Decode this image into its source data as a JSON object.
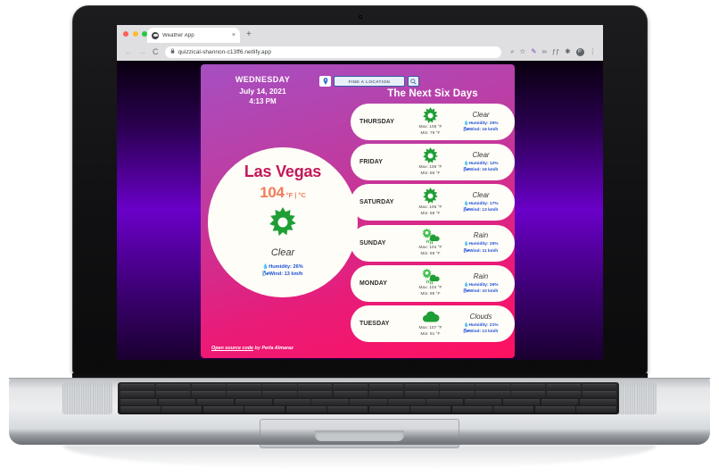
{
  "browser": {
    "tab_title": "Weather App",
    "tab_favicon": "partly-cloudy-icon",
    "tab_close": "×",
    "new_tab": "+",
    "back": "←",
    "forward": "→",
    "reload": "C",
    "lock": "🔒",
    "url": "quizzical-shannon-c13ff6.netlify.app",
    "zoom_icon": "⌕",
    "bookmark_icon": "☆",
    "ext1": "✎",
    "ext2": "∞",
    "ext3": "ƒƒ",
    "ext4": "✱",
    "profile_initial": "P",
    "menu_icon": "⋮"
  },
  "app": {
    "day_of_week": "WEDNESDAY",
    "date": "July 14, 2021",
    "time": "4:13 PM",
    "geo_icon": "location-pin-icon",
    "search_placeholder": "FIND A LOCATION",
    "search_icon": "search-icon",
    "forecast_title": "The Next Six Days",
    "current": {
      "city": "Las Vegas",
      "temperature": "104",
      "unit_active": "°F",
      "unit_separator": "|",
      "unit_inactive": "°C",
      "icon": "sun-icon",
      "condition": "Clear",
      "humidity": "Humidity: 26%",
      "wind": "Wind: 13 km/h",
      "humidity_icon": "droplet-icon",
      "wind_icon": "wind-icon"
    },
    "forecast": [
      {
        "day": "THURSDAY",
        "icon": "sun-icon",
        "max": "Max: 105 °F",
        "min": "Min: 79 °F",
        "condition": "Clear",
        "humidity": "Humidity: 25%",
        "wind": "Wind: 16 km/h"
      },
      {
        "day": "FRIDAY",
        "icon": "sun-icon",
        "max": "Max: 106 °F",
        "min": "Min: 86 °F",
        "condition": "Clear",
        "humidity": "Humidity: 12%",
        "wind": "Wind: 16 km/h"
      },
      {
        "day": "SATURDAY",
        "icon": "sun-icon",
        "max": "Max: 106 °F",
        "min": "Min: 88 °F",
        "condition": "Clear",
        "humidity": "Humidity: 17%",
        "wind": "Wind: 13 km/h"
      },
      {
        "day": "SUNDAY",
        "icon": "sun-rain-icon",
        "max": "Max: 104 °F",
        "min": "Min: 89 °F",
        "condition": "Rain",
        "humidity": "Humidity: 25%",
        "wind": "Wind: 11 km/h"
      },
      {
        "day": "MONDAY",
        "icon": "sun-rain-icon",
        "max": "Max: 104 °F",
        "min": "Min: 89 °F",
        "condition": "Rain",
        "humidity": "Humidity: 26%",
        "wind": "Wind: 10 km/h"
      },
      {
        "day": "TUESDAY",
        "icon": "cloud-icon",
        "max": "Max: 107 °F",
        "min": "Min: 91 °F",
        "condition": "Clouds",
        "humidity": "Humidity: 21%",
        "wind": "Wind: 13 km/h"
      }
    ],
    "footer": {
      "link": "Open source code",
      "by": "by",
      "author": "Perla Almaraz"
    }
  },
  "colors": {
    "city": "#c2185b",
    "temp": "#f07b5a",
    "metric": "#1f4fd8",
    "icon_green": "#1f9e36",
    "card_pink": "#e81c79",
    "card_purple": "#a64fc2"
  }
}
